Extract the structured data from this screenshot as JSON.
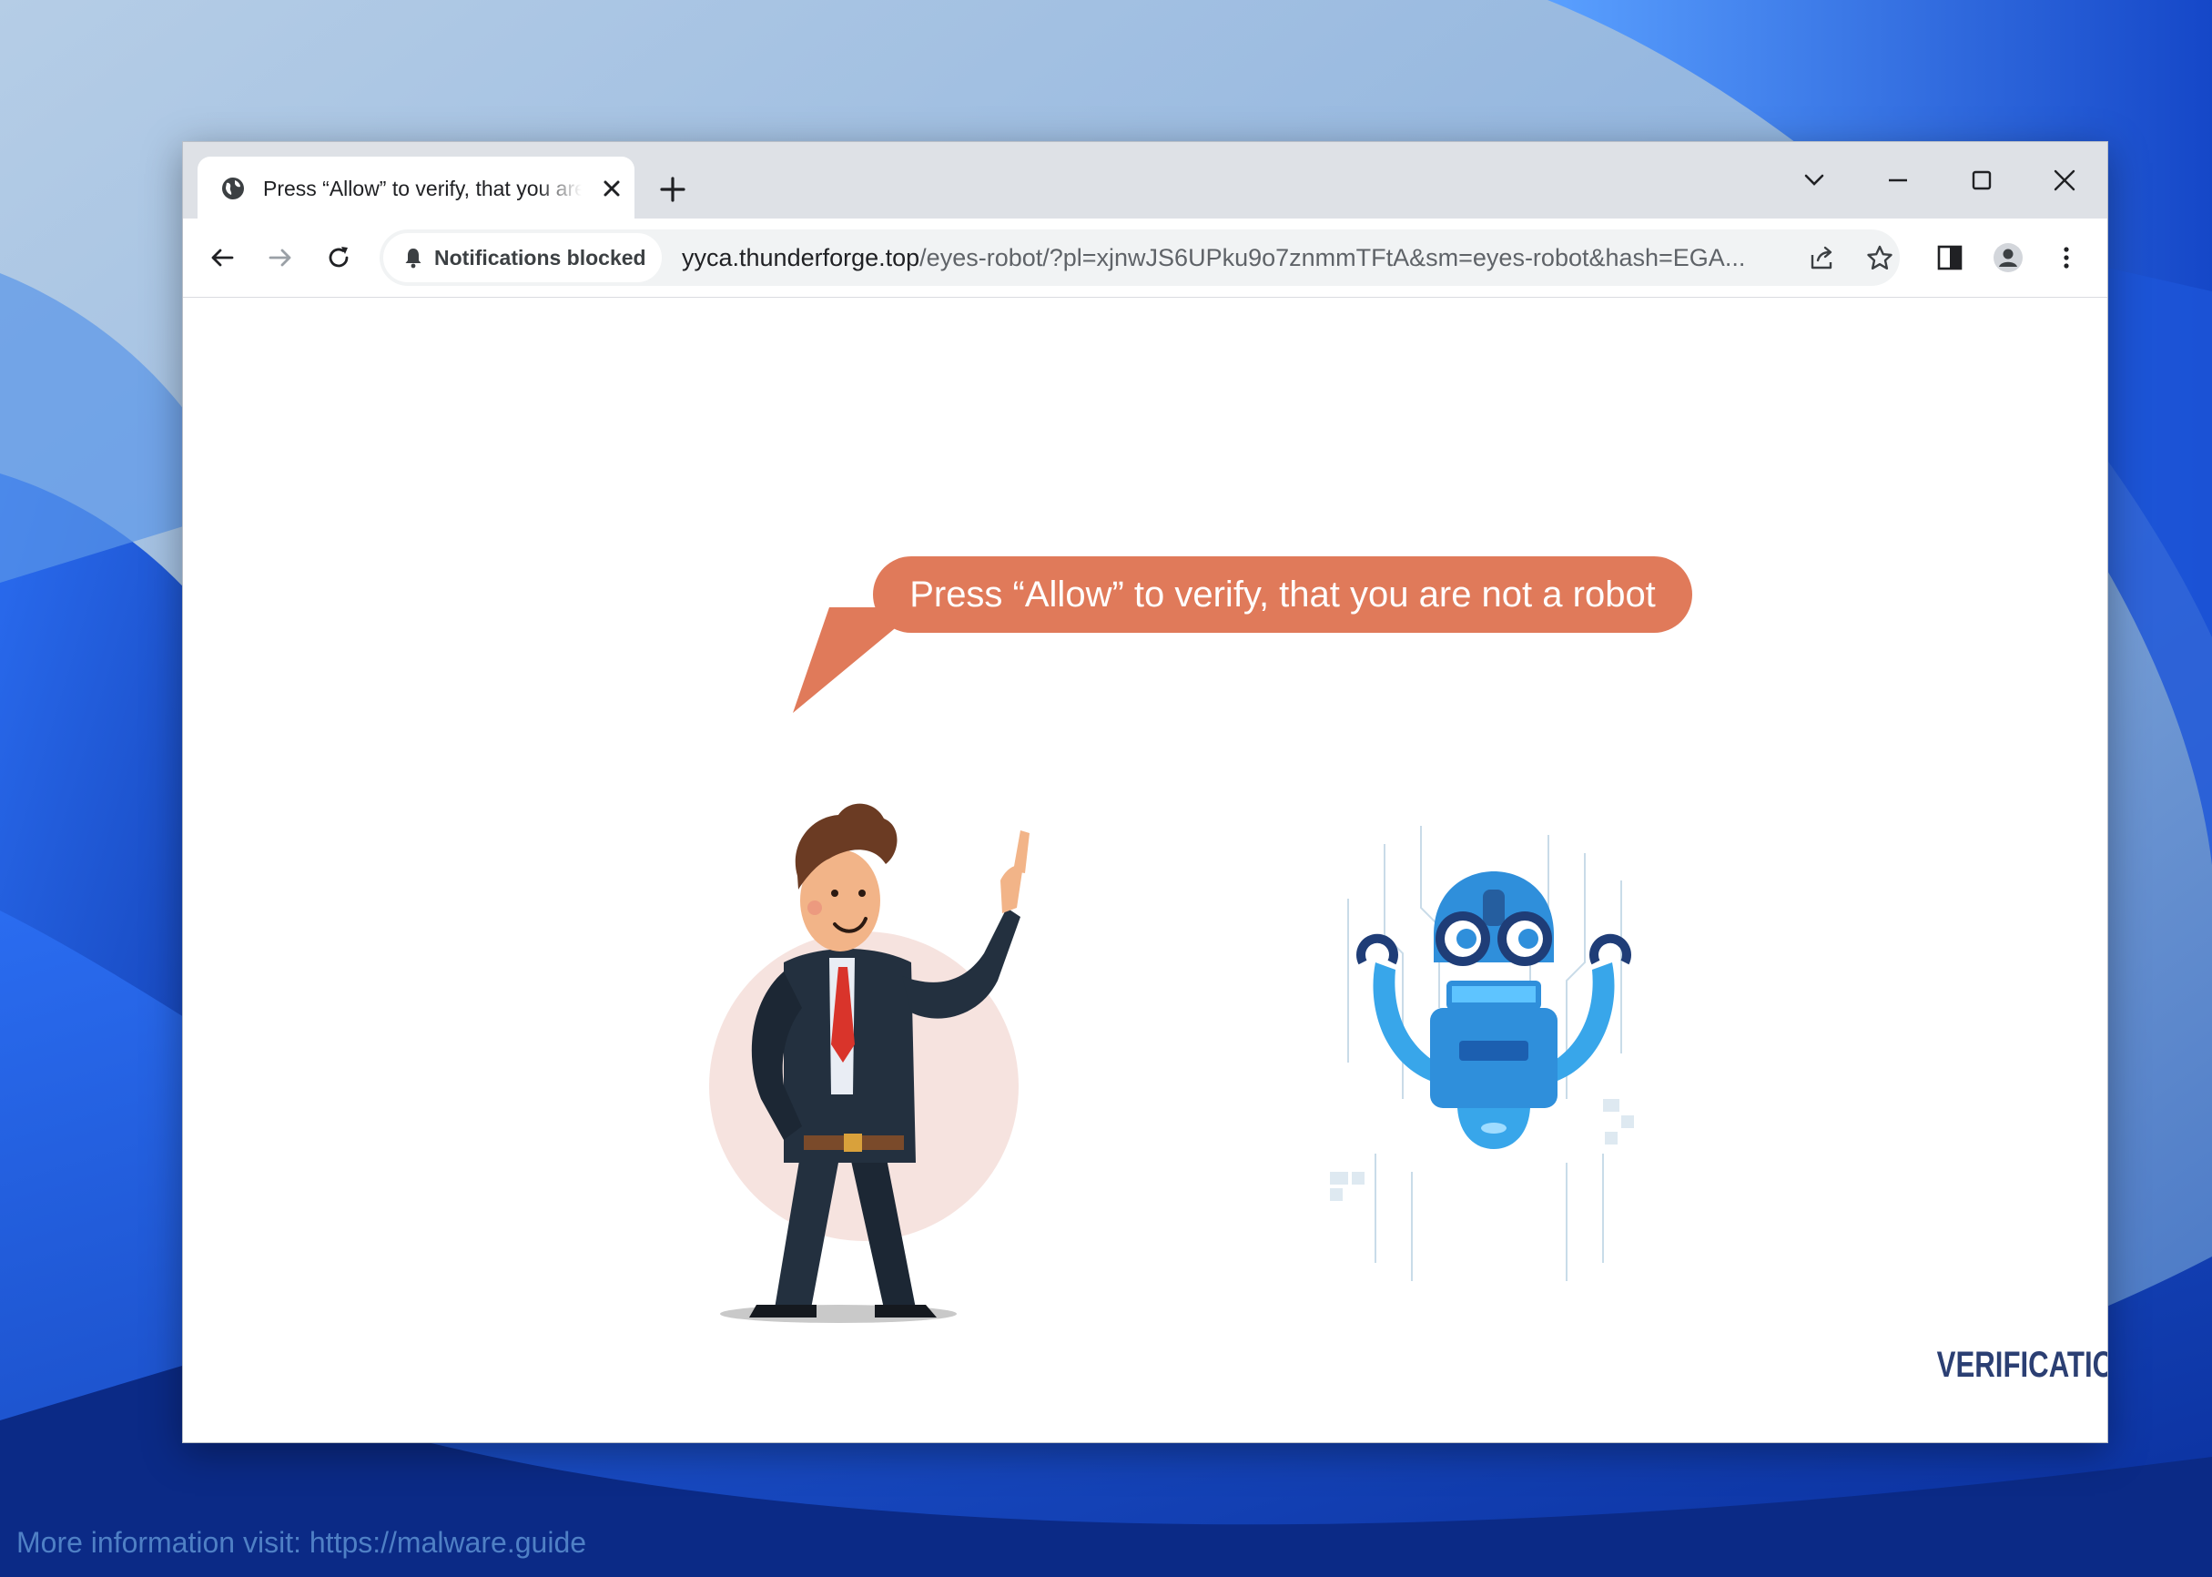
{
  "browser": {
    "tab": {
      "title": "Press “Allow” to verify, that you are not a robot",
      "favicon": "globe-icon"
    },
    "new_tab_icon": "plus-icon",
    "window_controls": [
      "chevron-down-icon",
      "minimize-icon",
      "maximize-icon",
      "close-icon"
    ],
    "nav": [
      "back-icon",
      "forward-icon",
      "reload-icon"
    ],
    "notification_chip": "Notifications blocked",
    "url_host": "yyca.thunderforge.top",
    "url_path": "/eyes-robot/?pl=xjnwJS6UPku9o7znmmTFtA&sm=eyes-robot&hash=EGA...",
    "omnibox_icons": [
      "share-icon",
      "star-icon"
    ],
    "toolbar_icons": [
      "side-panel-icon",
      "profile-icon",
      "menu-icon"
    ]
  },
  "page": {
    "speech_bubble": "Press “Allow” to verify, that you are not a robot",
    "brand": "VERIFICATION",
    "bubble_color": "#e07a5a",
    "brand_color": "#2b3f73"
  },
  "desktop": {
    "footer_note": "More information visit: https://malware.guide"
  }
}
